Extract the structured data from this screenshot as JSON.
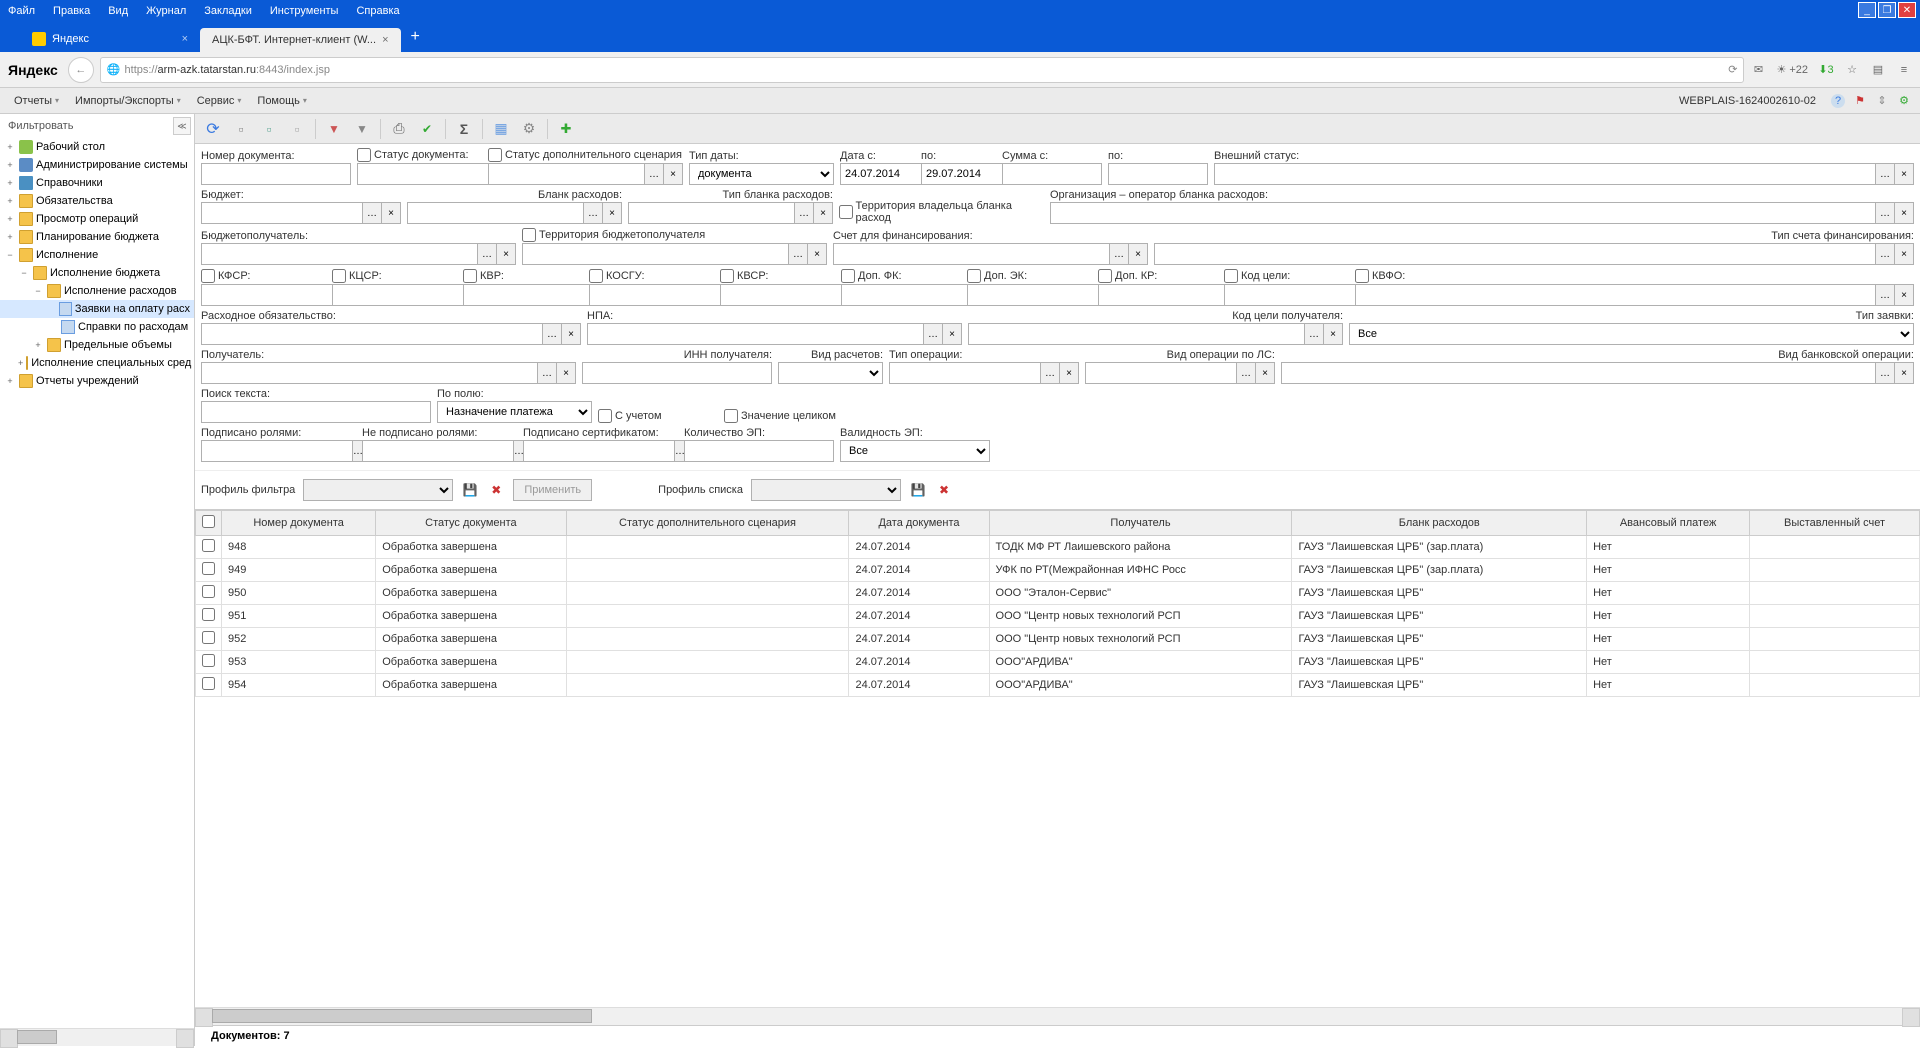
{
  "browser": {
    "menu": [
      "Файл",
      "Правка",
      "Вид",
      "Журнал",
      "Закладки",
      "Инструменты",
      "Справка"
    ],
    "tabs": [
      {
        "label": "Яндекс",
        "active": false
      },
      {
        "label": "АЦК-БФТ. Интернет-клиент (W...",
        "active": true
      }
    ],
    "logo": "Яндекс",
    "url_proto": "https://",
    "url_host": "arm-azk.tatarstan.ru",
    "url_port": ":8443",
    "url_path": "/index.jsp",
    "weather": "+22",
    "badge_count": "3"
  },
  "app": {
    "menus": [
      "Отчеты",
      "Импорты/Экспорты",
      "Сервис",
      "Помощь"
    ],
    "status": "WEBPLAIS-1624002610-02"
  },
  "sidebar": {
    "title": "Фильтровать",
    "tree": [
      {
        "depth": 0,
        "toggle": "+",
        "ico": "desktop",
        "label": "Рабочий стол"
      },
      {
        "depth": 0,
        "toggle": "+",
        "ico": "admin",
        "label": "Администрирование системы"
      },
      {
        "depth": 0,
        "toggle": "+",
        "ico": "book",
        "label": "Справочники"
      },
      {
        "depth": 0,
        "toggle": "+",
        "ico": "folder",
        "label": "Обязательства"
      },
      {
        "depth": 0,
        "toggle": "+",
        "ico": "folder",
        "label": "Просмотр операций"
      },
      {
        "depth": 0,
        "toggle": "+",
        "ico": "folder",
        "label": "Планирование бюджета"
      },
      {
        "depth": 0,
        "toggle": "−",
        "ico": "folder-open",
        "label": "Исполнение"
      },
      {
        "depth": 1,
        "toggle": "−",
        "ico": "folder-open",
        "label": "Исполнение бюджета"
      },
      {
        "depth": 2,
        "toggle": "−",
        "ico": "folder-open",
        "label": "Исполнение расходов"
      },
      {
        "depth": 3,
        "toggle": "",
        "ico": "doc",
        "label": "Заявки на оплату расх",
        "selected": true
      },
      {
        "depth": 3,
        "toggle": "",
        "ico": "doc",
        "label": "Справки по расходам"
      },
      {
        "depth": 2,
        "toggle": "+",
        "ico": "folder",
        "label": "Предельные объемы"
      },
      {
        "depth": 1,
        "toggle": "+",
        "ico": "folder",
        "label": "Исполнение специальных сред"
      },
      {
        "depth": 0,
        "toggle": "+",
        "ico": "folder",
        "label": "Отчеты учреждений"
      }
    ]
  },
  "filters": {
    "doc_number": "Номер документа:",
    "doc_status": "Статус документа:",
    "add_scenario_status": "Статус дополнительного сценария",
    "date_type_label": "Тип даты:",
    "date_type_value": "документа",
    "date_from_label": "Дата с:",
    "date_from": "24.07.2014",
    "date_to_label": "по:",
    "date_to": "29.07.2014",
    "sum_from_label": "Сумма с:",
    "sum_to_label": "по:",
    "external_status": "Внешний статус:",
    "budget": "Бюджет:",
    "expense_blank": "Бланк расходов:",
    "expense_blank_type": "Тип бланка расходов:",
    "owner_territory": "Территория владельца бланка расход",
    "operator_org": "Организация – оператор бланка расходов:",
    "budget_recipient": "Бюджетополучатель:",
    "recipient_territory": "Территория бюджетополучателя",
    "finance_account": "Счет для финансирования:",
    "finance_account_type": "Тип счета финансирования:",
    "kfsr": "КФСР:",
    "kcsr": "КЦСР:",
    "kvr": "КВР:",
    "kosgu": "КОСГУ:",
    "kvsr": "КВСР:",
    "dop_fk": "Доп. ФК:",
    "dop_ek": "Доп. ЭК:",
    "dop_kr": "Доп. КР:",
    "goal_code": "Код цели:",
    "kvfo": "КВФО:",
    "expense_obligation": "Расходное обязательство:",
    "npa": "НПА:",
    "recipient_goal_code": "Код цели получателя:",
    "request_type_label": "Тип заявки:",
    "request_type_value": "Все",
    "recipient": "Получатель:",
    "recipient_inn": "ИНН получателя:",
    "payment_type": "Вид расчетов:",
    "operation_type": "Тип операции:",
    "ls_operation_type": "Вид операции по ЛС:",
    "bank_operation_type": "Вид банковской операции:",
    "text_search": "Поиск текста:",
    "by_field_label": "По полю:",
    "by_field_value": "Назначение платежа",
    "with_account": "С учетом",
    "whole_value": "Значение целиком",
    "signed_roles": "Подписано ролями:",
    "unsigned_roles": "Не подписано ролями:",
    "signed_cert": "Подписано сертификатом:",
    "ep_count": "Количество ЭП:",
    "ep_validity_label": "Валидность ЭП:",
    "ep_validity_value": "Все"
  },
  "profile": {
    "filter_label": "Профиль фильтра",
    "apply_label": "Применить",
    "list_label": "Профиль списка"
  },
  "table": {
    "columns": [
      "",
      "Номер документа",
      "Статус документа",
      "Статус дополнительного сценария",
      "Дата документа",
      "Получатель",
      "Бланк расходов",
      "Авансовый платеж",
      "Выставленный счет"
    ],
    "rows": [
      {
        "num": "948",
        "status": "Обработка завершена",
        "scenario": "",
        "date": "24.07.2014",
        "recipient": "ТОДК МФ РТ Лаишевского района",
        "blank": "ГАУЗ \"Лаишевская ЦРБ\" (зар.плата)",
        "advance": "Нет",
        "invoice": ""
      },
      {
        "num": "949",
        "status": "Обработка завершена",
        "scenario": "",
        "date": "24.07.2014",
        "recipient": "УФК по РТ(Межрайонная ИФНС Росс",
        "blank": "ГАУЗ \"Лаишевская ЦРБ\" (зар.плата)",
        "advance": "Нет",
        "invoice": ""
      },
      {
        "num": "950",
        "status": "Обработка завершена",
        "scenario": "",
        "date": "24.07.2014",
        "recipient": "ООО \"Эталон-Сервис\"",
        "blank": "ГАУЗ \"Лаишевская ЦРБ\"",
        "advance": "Нет",
        "invoice": ""
      },
      {
        "num": "951",
        "status": "Обработка завершена",
        "scenario": "",
        "date": "24.07.2014",
        "recipient": "ООО \"Центр новых технологий РСП",
        "blank": "ГАУЗ \"Лаишевская ЦРБ\"",
        "advance": "Нет",
        "invoice": ""
      },
      {
        "num": "952",
        "status": "Обработка завершена",
        "scenario": "",
        "date": "24.07.2014",
        "recipient": "ООО \"Центр новых технологий РСП",
        "blank": "ГАУЗ \"Лаишевская ЦРБ\"",
        "advance": "Нет",
        "invoice": ""
      },
      {
        "num": "953",
        "status": "Обработка завершена",
        "scenario": "",
        "date": "24.07.2014",
        "recipient": "ООО\"АРДИВА\"",
        "blank": "ГАУЗ \"Лаишевская ЦРБ\"",
        "advance": "Нет",
        "invoice": ""
      },
      {
        "num": "954",
        "status": "Обработка завершена",
        "scenario": "",
        "date": "24.07.2014",
        "recipient": "ООО\"АРДИВА\"",
        "blank": "ГАУЗ \"Лаишевская ЦРБ\"",
        "advance": "Нет",
        "invoice": ""
      }
    ]
  },
  "footer": {
    "doc_count_label": "Документов: 7"
  }
}
